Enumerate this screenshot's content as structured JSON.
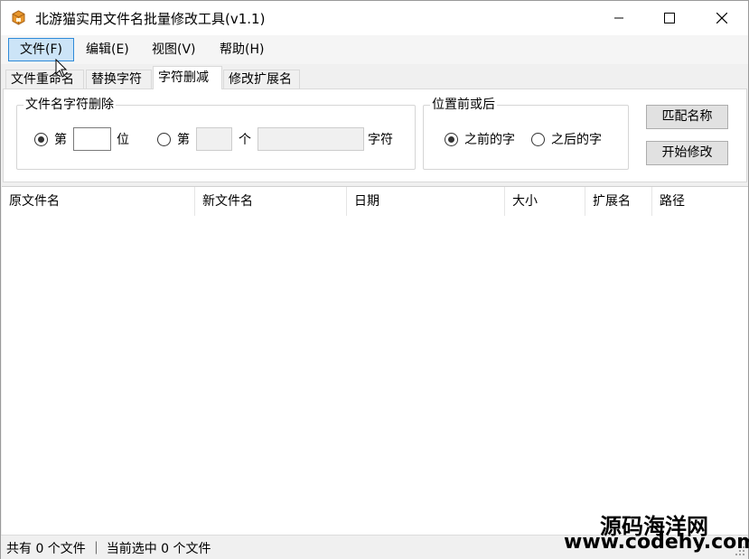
{
  "window": {
    "title": "北游猫实用文件名批量修改工具(v1.1)"
  },
  "menu": {
    "items": [
      {
        "label": "文件(F)"
      },
      {
        "label": "编辑(E)"
      },
      {
        "label": "视图(V)"
      },
      {
        "label": "帮助(H)"
      }
    ]
  },
  "tabs": [
    {
      "label": "文件重命名"
    },
    {
      "label": "替换字符"
    },
    {
      "label": "字符删减"
    },
    {
      "label": "修改扩展名"
    }
  ],
  "selected_tab": "字符删减",
  "delete_group": {
    "legend": "文件名字符删除",
    "radio1_prefix": "第",
    "radio1_suffix": "位",
    "radio2_prefix": "第",
    "radio2_middle": "个",
    "radio2_suffix": "字符",
    "position_value": "",
    "count_value": "",
    "text_value": ""
  },
  "position_group": {
    "legend": "位置前或后",
    "before_label": "之前的字",
    "after_label": "之后的字"
  },
  "buttons": {
    "match_label": "匹配名称",
    "start_label": "开始修改"
  },
  "list": {
    "columns": [
      "原文件名",
      "新文件名",
      "日期",
      "大小",
      "扩展名",
      "路径"
    ]
  },
  "status": {
    "text": "共有 0 个文件 ｜ 当前选中 0 个文件"
  },
  "watermark": {
    "cn": "源码海洋网",
    "en": "www.codehy.com"
  },
  "colors": {
    "menu_active_bg": "#cce4f7",
    "menu_active_border": "#2e8ad8",
    "icon_orange": "#e8962b"
  }
}
